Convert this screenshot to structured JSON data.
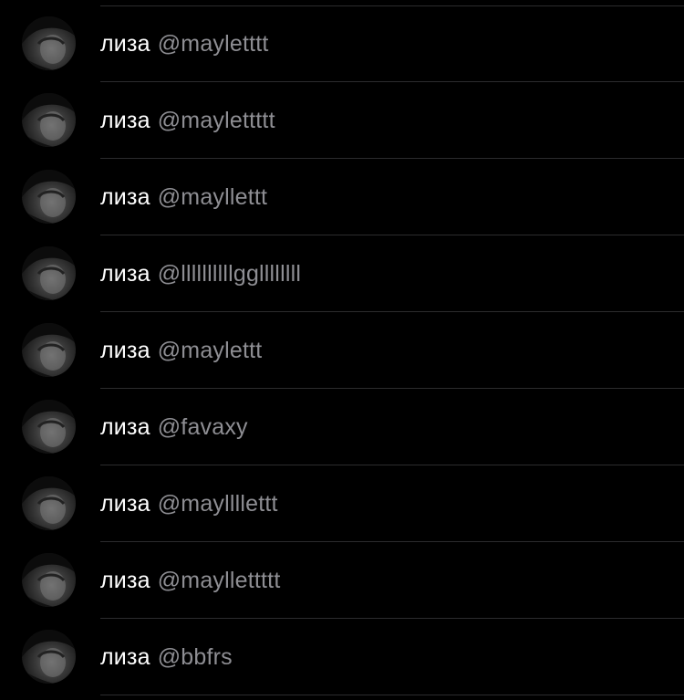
{
  "accounts": [
    {
      "name": "лиза",
      "handle": "@mayletttt"
    },
    {
      "name": "лиза",
      "handle": "@maylettttt"
    },
    {
      "name": "лиза",
      "handle": "@mayllettt"
    },
    {
      "name": "лиза",
      "handle": "@llllllllllggllllllll"
    },
    {
      "name": "лиза",
      "handle": "@maylettt"
    },
    {
      "name": "лиза",
      "handle": "@favaxy"
    },
    {
      "name": "лиза",
      "handle": "@mayllllettt"
    },
    {
      "name": "лиза",
      "handle": "@mayllettttt"
    },
    {
      "name": "лиза",
      "handle": "@bbfrs"
    }
  ],
  "icons": {
    "avatar": "profile-photo"
  },
  "colors": {
    "background": "#000000",
    "name_text": "#ffffff",
    "handle_text": "#8e8e93",
    "divider": "#2c2c2e"
  }
}
